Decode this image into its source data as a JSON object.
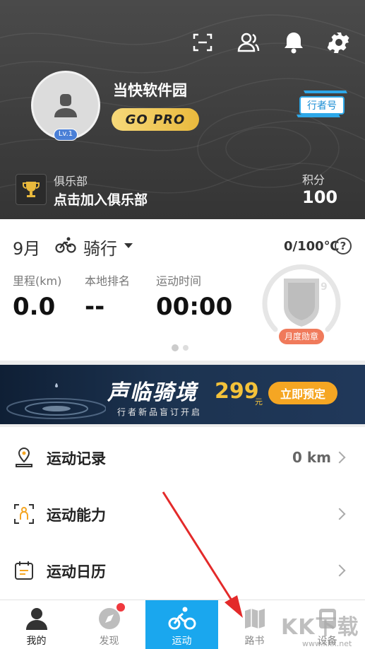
{
  "header": {
    "username": "当快软件园",
    "level": "Lv.1",
    "badge_label": "GO PRO",
    "xingzhe_label": "行者号",
    "icons": [
      "scan-icon",
      "friends-icon",
      "bell-icon",
      "gear-icon"
    ],
    "club_label": "俱乐部",
    "club_action": "点击加入俱乐部",
    "points_label": "积分",
    "points_value": "100"
  },
  "stats": {
    "month": "9月",
    "sport": "骑行",
    "temperature": "0/100℃",
    "help": "?",
    "items": [
      {
        "label": "里程(km)",
        "value": "0.0"
      },
      {
        "label": "本地排名",
        "value": "--"
      },
      {
        "label": "运动时间",
        "value": "00:00"
      }
    ],
    "badge_tag": "月度勋章"
  },
  "banner": {
    "title": "声临骑境",
    "subtitle": "行者新品盲订开启",
    "price": "299",
    "price_unit": "元",
    "cta": "立即预定"
  },
  "menu": [
    {
      "label": "运动记录",
      "value": "0 km",
      "icon": "location-record-icon"
    },
    {
      "label": "运动能力",
      "value": "",
      "icon": "person-focus-icon"
    },
    {
      "label": "运动日历",
      "value": "",
      "icon": "calendar-icon"
    }
  ],
  "tabs": [
    {
      "label": "我的",
      "icon": "person-icon"
    },
    {
      "label": "发现",
      "icon": "compass-icon"
    },
    {
      "label": "运动",
      "icon": "cyclist-icon"
    },
    {
      "label": "路书",
      "icon": "map-book-icon"
    },
    {
      "label": "设备",
      "icon": "device-icon"
    }
  ],
  "watermark": {
    "main": "KK下载",
    "sub": "www.kkx.net"
  },
  "colors": {
    "accent": "#1aa7ee",
    "gold": "#f4c23a",
    "badge": "#f07a5b",
    "header_bg": "#3f3f3f"
  }
}
